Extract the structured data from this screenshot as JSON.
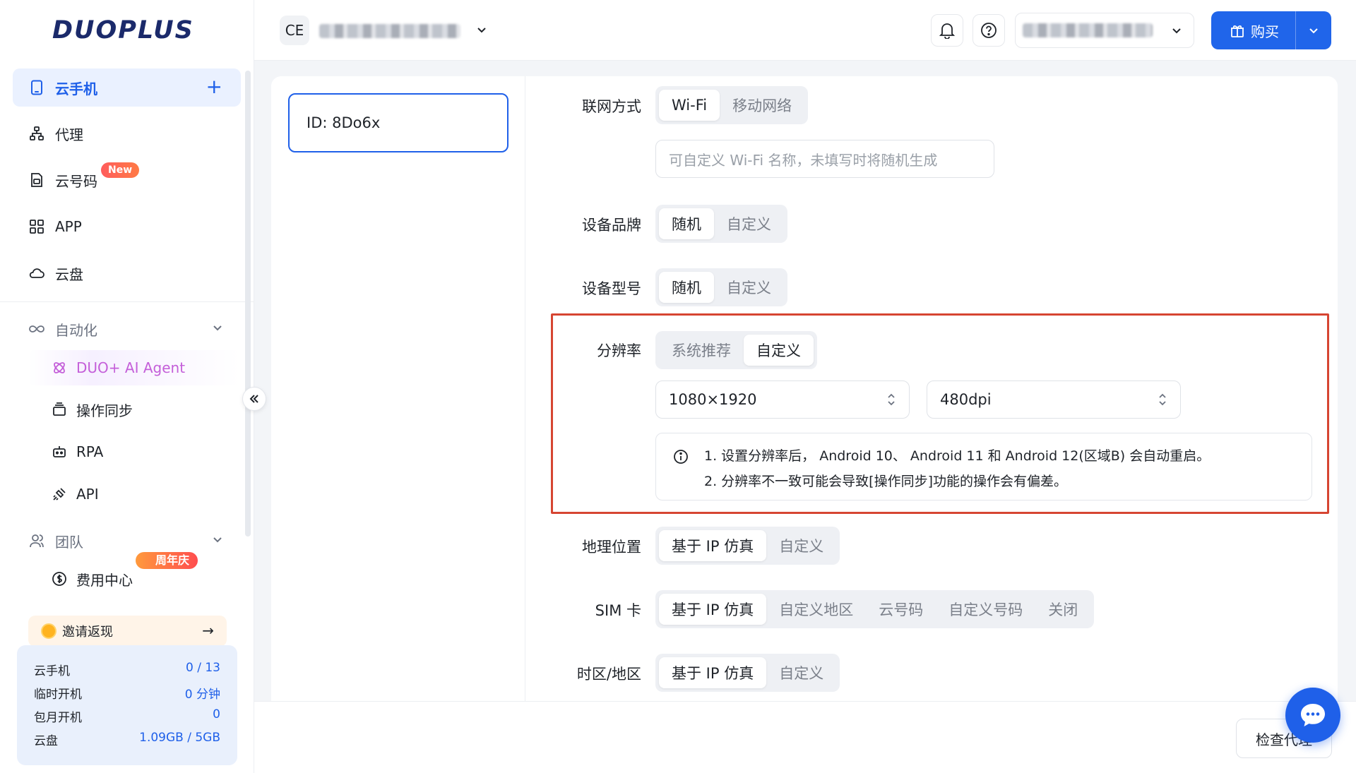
{
  "brand": {
    "logo_text": "DUOPLUS"
  },
  "sidebar": {
    "nav": [
      {
        "label": "云手机",
        "icon": "phone-icon",
        "active": true
      },
      {
        "label": "代理",
        "icon": "network-icon"
      },
      {
        "label": "云号码",
        "icon": "sim-icon",
        "badge": "New"
      },
      {
        "label": "APP",
        "icon": "apps-grid-icon"
      },
      {
        "label": "云盘",
        "icon": "cloud-icon"
      }
    ],
    "automation": {
      "title": "自动化",
      "items": [
        {
          "label": "DUO+ AI Agent",
          "icon": "ai-agent-icon"
        },
        {
          "label": "操作同步",
          "icon": "sync-icon"
        },
        {
          "label": "RPA",
          "icon": "robot-icon"
        },
        {
          "label": "API",
          "icon": "plug-icon"
        }
      ]
    },
    "team": {
      "title": "团队",
      "items": [
        {
          "label": "费用中心",
          "icon": "dollar-icon",
          "badge": "周年庆"
        }
      ]
    },
    "invite": {
      "label": "邀请返现"
    },
    "stats": [
      {
        "label": "云手机",
        "value": "0 / 13"
      },
      {
        "label": "临时开机",
        "value": "0 分钟"
      },
      {
        "label": "包月开机",
        "value": "0"
      },
      {
        "label": "云盘",
        "value": "1.09GB / 5GB"
      }
    ]
  },
  "header": {
    "workspace_initials": "CE",
    "buy_label": "购买"
  },
  "device": {
    "id_label": "ID: 8Do6x"
  },
  "form": {
    "network": {
      "label": "联网方式",
      "options": [
        "Wi-Fi",
        "移动网络"
      ],
      "selected": "Wi-Fi",
      "wifi_placeholder": "可自定义 Wi-Fi 名称，未填写时将随机生成"
    },
    "brand": {
      "label": "设备品牌",
      "options": [
        "随机",
        "自定义"
      ],
      "selected": "随机"
    },
    "model": {
      "label": "设备型号",
      "options": [
        "随机",
        "自定义"
      ],
      "selected": "随机"
    },
    "resolution": {
      "label": "分辨率",
      "options": [
        "系统推荐",
        "自定义"
      ],
      "selected": "自定义",
      "size_value": "1080×1920",
      "dpi_value": "480dpi",
      "notice_line1": "1. 设置分辨率后， Android 10、 Android 11 和 Android 12(区域B) 会自动重启。",
      "notice_line2": "2. 分辨率不一致可能会导致[操作同步]功能的操作会有偏差。"
    },
    "location": {
      "label": "地理位置",
      "options": [
        "基于 IP 仿真",
        "自定义"
      ],
      "selected": "基于 IP 仿真"
    },
    "sim": {
      "label": "SIM 卡",
      "options": [
        "基于 IP 仿真",
        "自定义地区",
        "云号码",
        "自定义号码",
        "关闭"
      ],
      "selected": "基于 IP 仿真"
    },
    "timezone": {
      "label": "时区/地区",
      "options": [
        "基于 IP 仿真",
        "自定义"
      ],
      "selected": "基于 IP 仿真"
    }
  },
  "footer": {
    "check_proxy_label": "检查代理"
  },
  "colors": {
    "primary": "#1f60e9",
    "highlight": "#d64532",
    "badge_new": "#ff5c5c"
  }
}
